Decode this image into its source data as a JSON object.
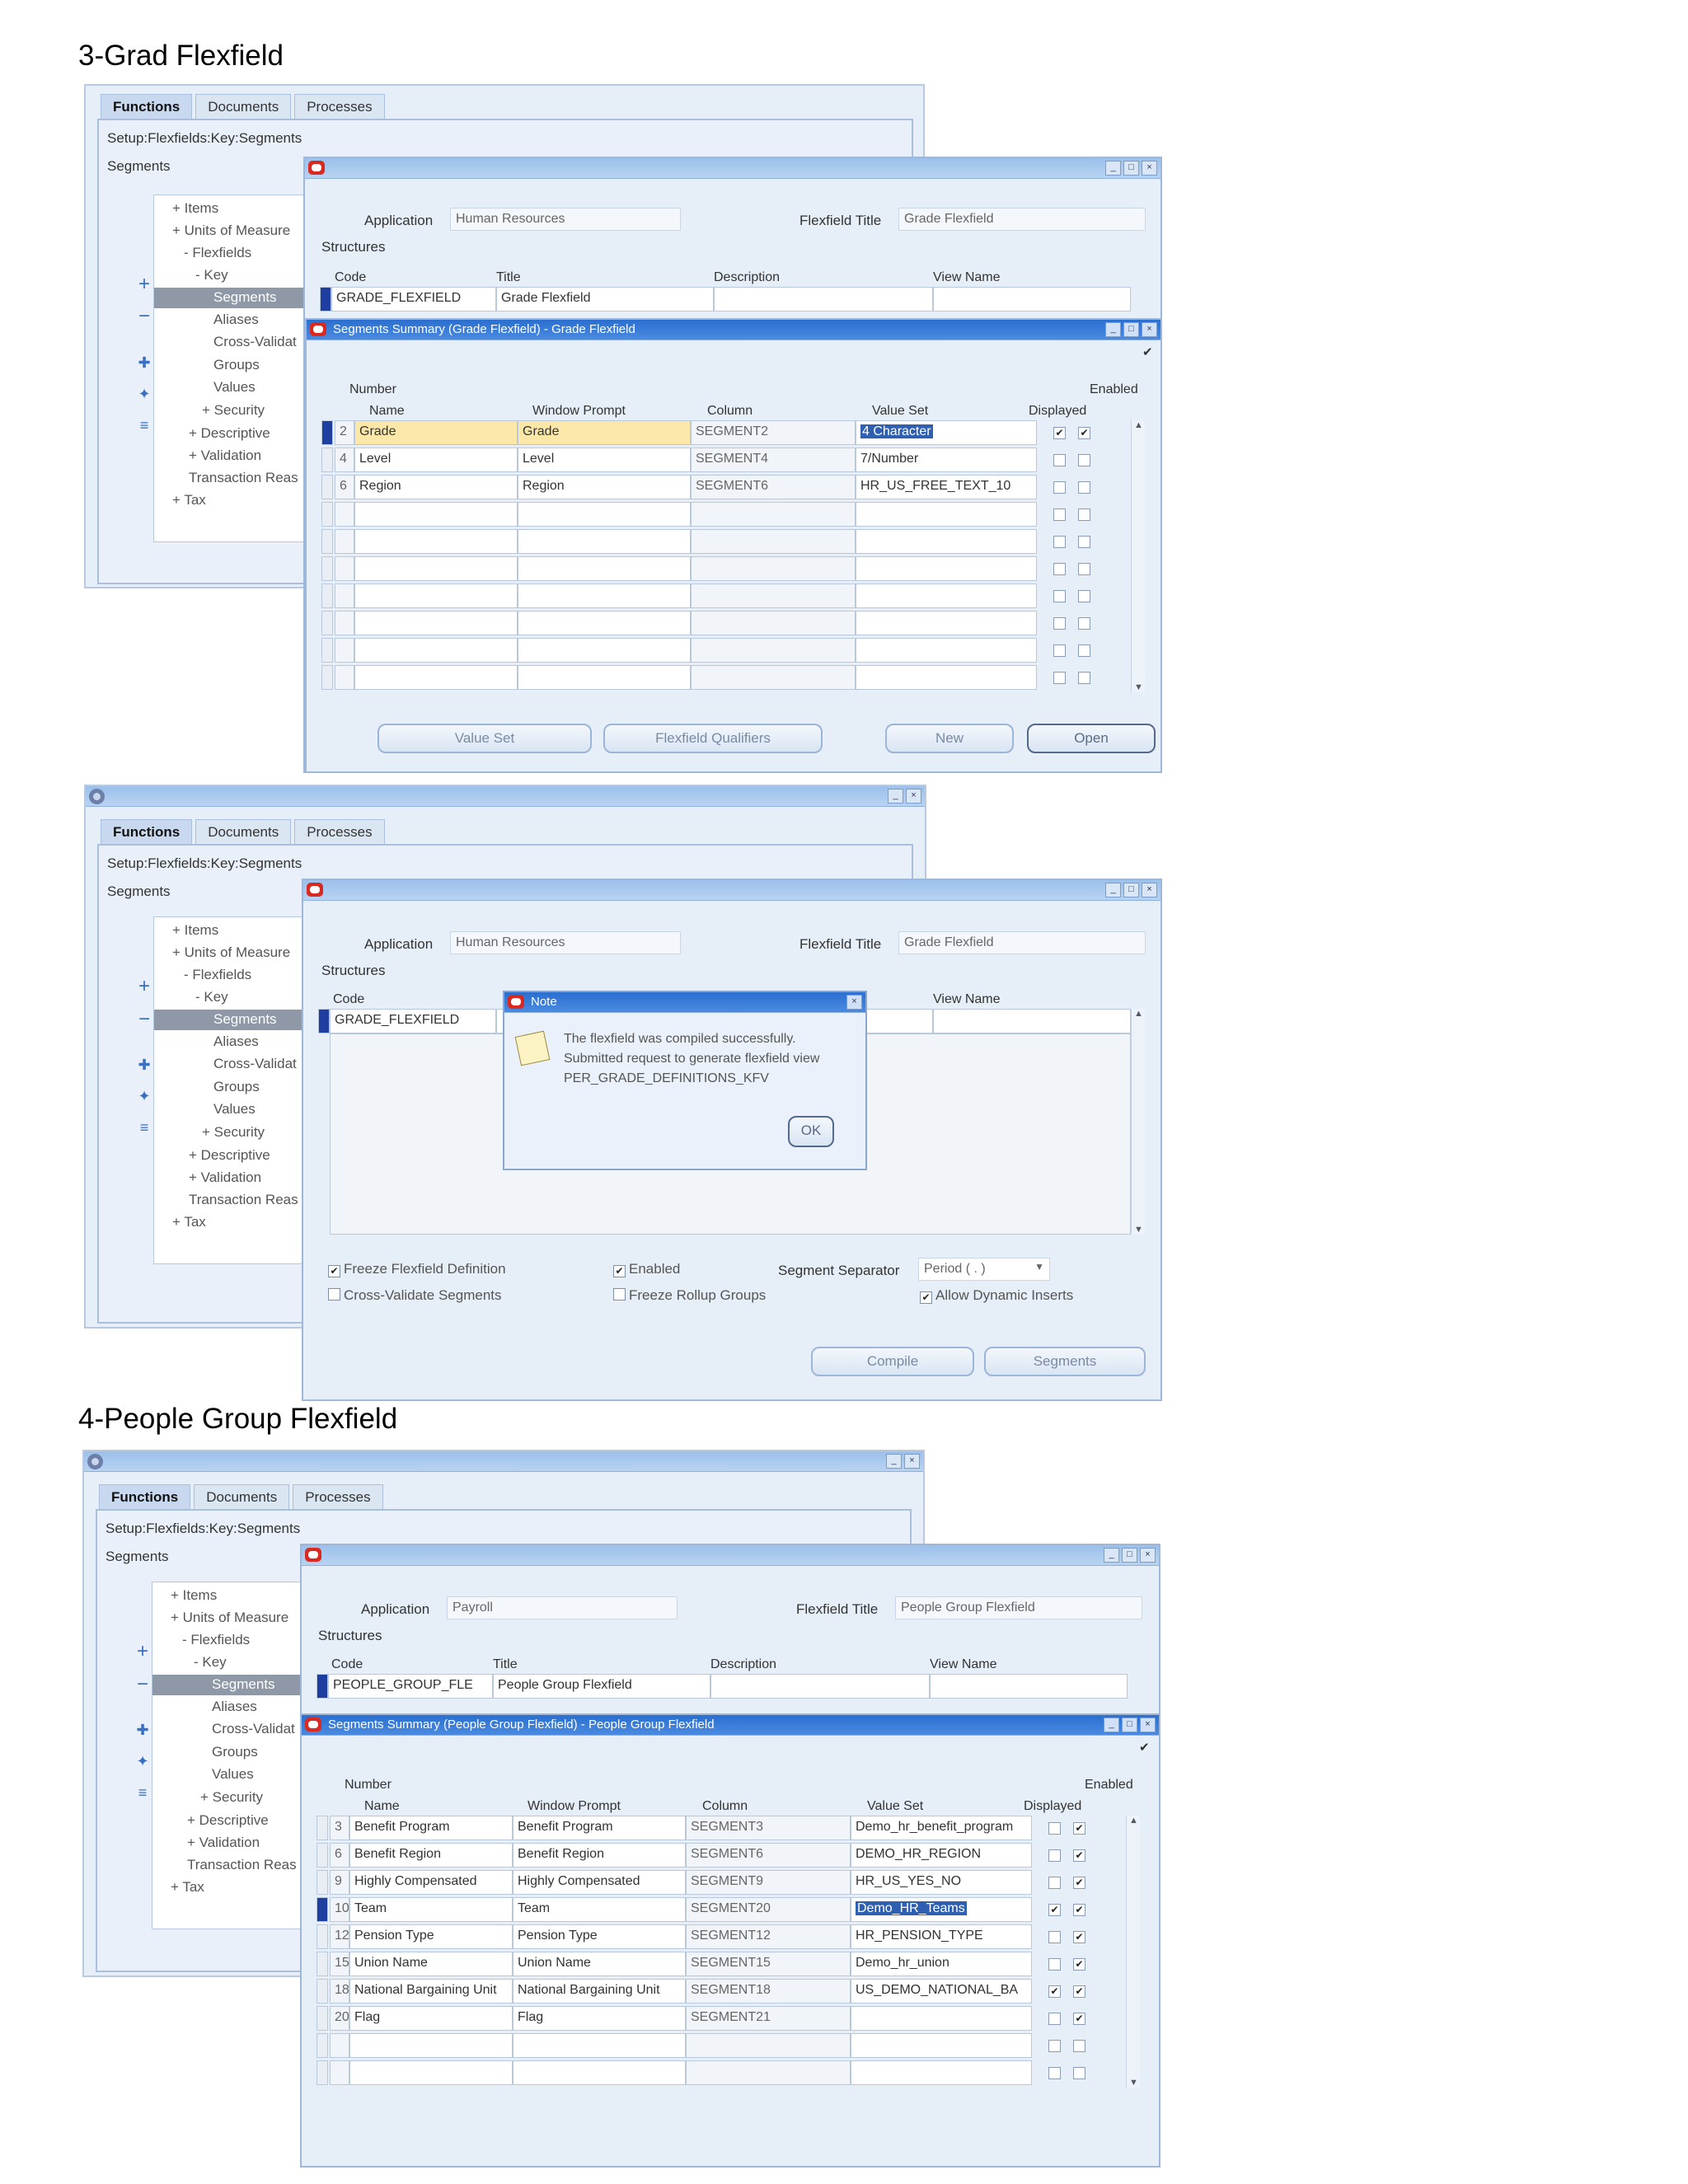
{
  "headings": {
    "grade": "3-Grad Flexfield",
    "people": "4-People Group Flexfield"
  },
  "colors": {
    "titlebar_active": "#2a6fd0",
    "titlebar_inactive": "#b8d3f2",
    "highlight_cell": "#fbe7a8",
    "selected_value": "#2f5fb0",
    "tree_selection": "#8e98a6"
  },
  "navigator": {
    "tabs": [
      "Functions",
      "Documents",
      "Processes"
    ],
    "breadcrumb": "Setup:Flexfields:Key:Segments",
    "list_label": "Segments",
    "tree": [
      "+ Items",
      "+ Units of Measure",
      "- Flexfields",
      "- Key",
      "Segments",
      "Aliases",
      "Cross-Validat",
      "Groups",
      "Values",
      "+ Security",
      "+ Descriptive",
      "+ Validation",
      "Transaction Reas",
      "+ Tax"
    ],
    "side_icons": [
      "expand-icon",
      "collapse-icon",
      "expand-all-icon",
      "collapse-all-icon",
      "branch-icon"
    ]
  },
  "kff_window": {
    "labels": {
      "application": "Application",
      "flexfield_title": "Flexfield Title",
      "structures": "Structures",
      "code": "Code",
      "title": "Title",
      "description": "Description",
      "view_name": "View Name"
    }
  },
  "summary_headers": {
    "number": "Number",
    "name": "Name",
    "window_prompt": "Window Prompt",
    "column": "Column",
    "value_set": "Value Set",
    "enabled": "Enabled",
    "displayed": "Displayed"
  },
  "grade": {
    "application": "Human Resources",
    "flexfield_title": "Grade Flexfield",
    "structure": {
      "code": "GRADE_FLEXFIELD",
      "title": "Grade Flexfield"
    },
    "summary_title": "Segments Summary (Grade Flexfield) - Grade Flexfield",
    "segments": [
      {
        "number": "2",
        "name": "Grade",
        "prompt": "Grade",
        "column": "SEGMENT2",
        "value_set": "4 Character",
        "displayed": "✔",
        "enabled": "✔"
      },
      {
        "number": "4",
        "name": "Level",
        "prompt": "Level",
        "column": "SEGMENT4",
        "value_set": "7/Number",
        "displayed": "",
        "enabled": ""
      },
      {
        "number": "6",
        "name": "Region",
        "prompt": "Region",
        "column": "SEGMENT6",
        "value_set": "HR_US_FREE_TEXT_10",
        "displayed": "",
        "enabled": ""
      }
    ],
    "buttons": {
      "value_set": "Value Set",
      "qualifiers": "Flexfield Qualifiers",
      "new": "New",
      "open": "Open"
    }
  },
  "grade_compiled": {
    "note_title": "Note",
    "note_lines": [
      "The flexfield was compiled successfully.",
      "Submitted request to generate flexfield view",
      "PER_GRADE_DEFINITIONS_KFV"
    ],
    "ok": "OK",
    "options": {
      "freeze": "Freeze Flexfield Definition",
      "cross_validate": "Cross-Validate Segments",
      "enabled": "Enabled",
      "freeze_rollup": "Freeze Rollup Groups",
      "separator_label": "Segment Separator",
      "separator_value": "Period ( . )",
      "dynamic_inserts": "Allow Dynamic Inserts"
    },
    "buttons": {
      "compile": "Compile",
      "segments": "Segments"
    }
  },
  "people": {
    "application": "Payroll",
    "flexfield_title": "People Group Flexfield",
    "structure": {
      "code": "PEOPLE_GROUP_FLE",
      "title": "People Group Flexfield"
    },
    "summary_title": "Segments Summary (People Group Flexfield) - People Group Flexfield",
    "segments": [
      {
        "number": "3",
        "name": "Benefit Program",
        "prompt": "Benefit Program",
        "column": "SEGMENT3",
        "value_set": "Demo_hr_benefit_program",
        "displayed": "",
        "enabled": "✔"
      },
      {
        "number": "6",
        "name": "Benefit Region",
        "prompt": "Benefit Region",
        "column": "SEGMENT6",
        "value_set": "DEMO_HR_REGION",
        "displayed": "",
        "enabled": "✔"
      },
      {
        "number": "9",
        "name": "Highly Compensated",
        "prompt": "Highly Compensated",
        "column": "SEGMENT9",
        "value_set": "HR_US_YES_NO",
        "displayed": "",
        "enabled": "✔"
      },
      {
        "number": "10",
        "name": "Team",
        "prompt": "Team",
        "column": "SEGMENT20",
        "value_set": "Demo_HR_Teams",
        "displayed": "✔",
        "enabled": "✔"
      },
      {
        "number": "12",
        "name": "Pension Type",
        "prompt": "Pension Type",
        "column": "SEGMENT12",
        "value_set": "HR_PENSION_TYPE",
        "displayed": "",
        "enabled": "✔"
      },
      {
        "number": "15",
        "name": "Union Name",
        "prompt": "Union Name",
        "column": "SEGMENT15",
        "value_set": "Demo_hr_union",
        "displayed": "",
        "enabled": "✔"
      },
      {
        "number": "18",
        "name": "National Bargaining Unit",
        "prompt": "National Bargaining Unit",
        "column": "SEGMENT18",
        "value_set": "US_DEMO_NATIONAL_BA",
        "displayed": "✔",
        "enabled": "✔"
      },
      {
        "number": "20",
        "name": "Flag",
        "prompt": "Flag",
        "column": "SEGMENT21",
        "value_set": "",
        "displayed": "",
        "enabled": "✔"
      }
    ]
  }
}
